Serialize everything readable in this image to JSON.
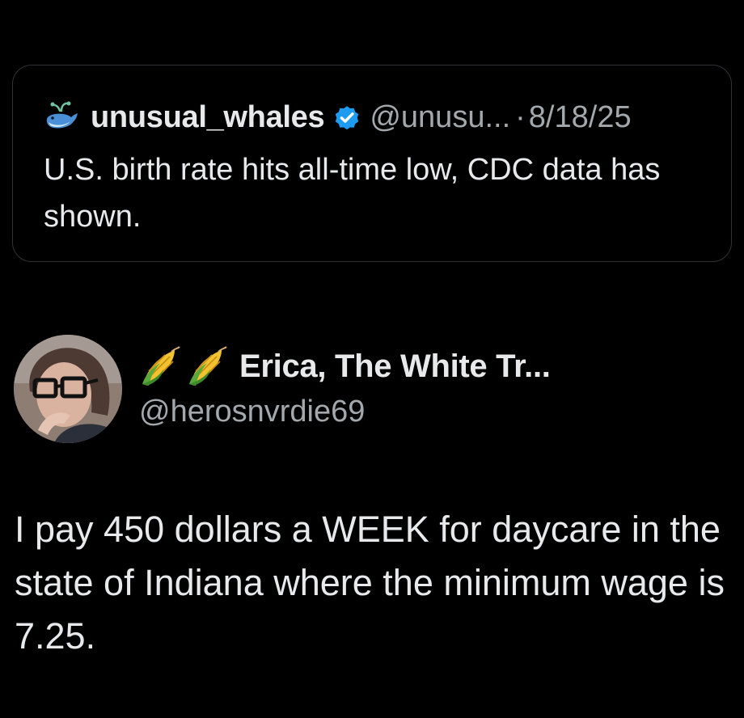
{
  "quoted_tweet": {
    "display_name": "unusual_whales",
    "handle": "@unusu...",
    "separator": "·",
    "date": "8/18/25",
    "text": "U.S. birth rate hits all-time low, CDC data has shown.",
    "icons": {
      "avatar": "whale-icon",
      "badge": "verified-badge-icon"
    }
  },
  "tweet": {
    "display_name": "Erica, The White Tr...",
    "handle": "@herosnvrdie69",
    "name_emojis": [
      "corn-icon",
      "corn-icon"
    ],
    "text": "I pay 450 dollars a WEEK for daycare in the state of Indiana where the minimum wage is 7.25."
  },
  "colors": {
    "background": "#000000",
    "primary_text": "#e7e9ea",
    "secondary_text": "#a3a8ad",
    "card_border": "#2f3336",
    "verified_blue": "#1d9bf0"
  }
}
